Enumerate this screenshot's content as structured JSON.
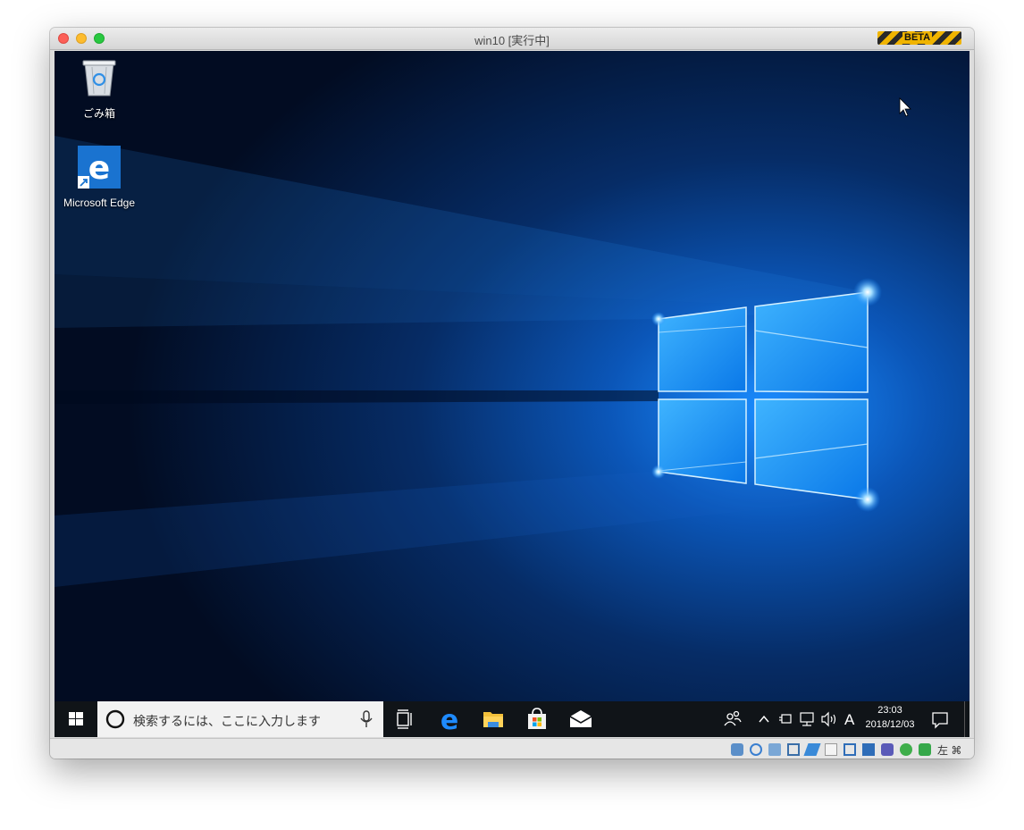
{
  "window": {
    "title": "win10 [実行中]",
    "badge": "BETA"
  },
  "desktop": {
    "icons": [
      {
        "label": "ごみ箱",
        "icon": "recycle-bin-icon"
      },
      {
        "label": "Microsoft Edge",
        "icon": "edge-icon"
      }
    ]
  },
  "taskbar": {
    "search_placeholder": "検索するには、ここに入力します",
    "pinned": [
      "task-view-icon",
      "edge-icon",
      "file-explorer-icon",
      "store-icon",
      "mail-icon"
    ],
    "tray": {
      "ime": "A",
      "time": "23:03",
      "date": "2018/12/03"
    }
  },
  "statusbar": {
    "host_key": "左 ⌘"
  },
  "colors": {
    "accent": "#0078d7",
    "taskbar": "#101418"
  }
}
